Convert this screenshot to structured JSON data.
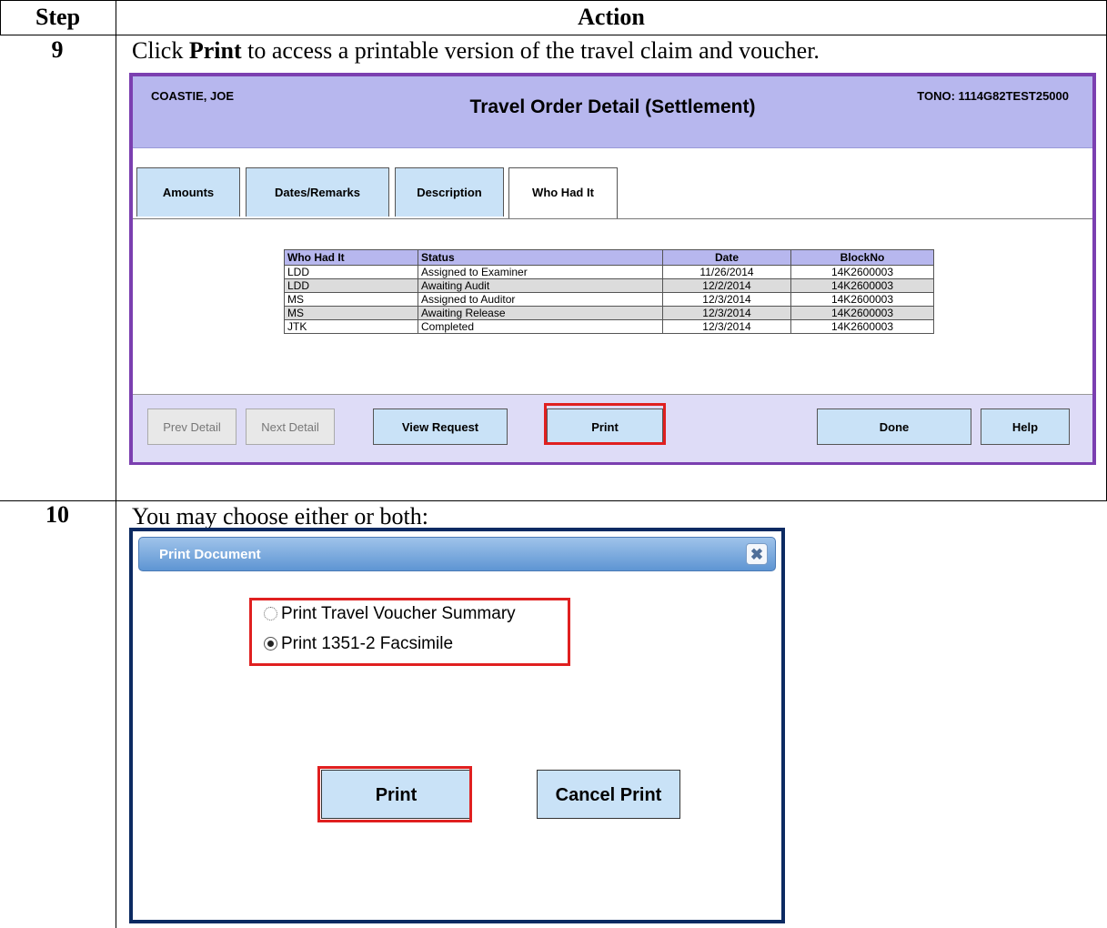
{
  "header": {
    "step": "Step",
    "action": "Action"
  },
  "rows": [
    {
      "step": "9",
      "instruction_prefix": "Click ",
      "instruction_bold": "Print",
      "instruction_suffix": " to access a printable version of the travel claim and voucher."
    },
    {
      "step": "10",
      "instruction": "You may choose either or both:"
    }
  ],
  "travel_order": {
    "member_name": "COASTIE, JOE",
    "title": "Travel Order Detail (Settlement)",
    "tono": "TONO: 1114G82TEST25000",
    "tabs": [
      "Amounts",
      "Dates/Remarks",
      "Description",
      "Who Had It"
    ],
    "active_tab": "Who Had It",
    "table": {
      "columns": [
        "Who Had It",
        "Status",
        "Date",
        "BlockNo"
      ],
      "rows": [
        [
          "LDD",
          "Assigned to Examiner",
          "11/26/2014",
          "14K2600003"
        ],
        [
          "LDD",
          "Awaiting Audit",
          "12/2/2014",
          "14K2600003"
        ],
        [
          "MS",
          "Assigned to Auditor",
          "12/3/2014",
          "14K2600003"
        ],
        [
          "MS",
          "Awaiting Release",
          "12/3/2014",
          "14K2600003"
        ],
        [
          "JTK",
          "Completed",
          "12/3/2014",
          "14K2600003"
        ]
      ]
    },
    "buttons": {
      "prev_detail": "Prev Detail",
      "next_detail": "Next Detail",
      "view_request": "View Request",
      "print": "Print",
      "done": "Done",
      "help": "Help"
    },
    "highlight_color": "#e02020",
    "border_color": "#7b3fb0"
  },
  "print_dialog": {
    "title": "Print Document",
    "close_symbol": "✖",
    "options": [
      {
        "label": "Print Travel Voucher Summary",
        "selected": false
      },
      {
        "label": "Print 1351-2 Facsimile",
        "selected": true
      }
    ],
    "print_label": "Print",
    "cancel_label": "Cancel Print",
    "border_color": "#0c2a62"
  }
}
